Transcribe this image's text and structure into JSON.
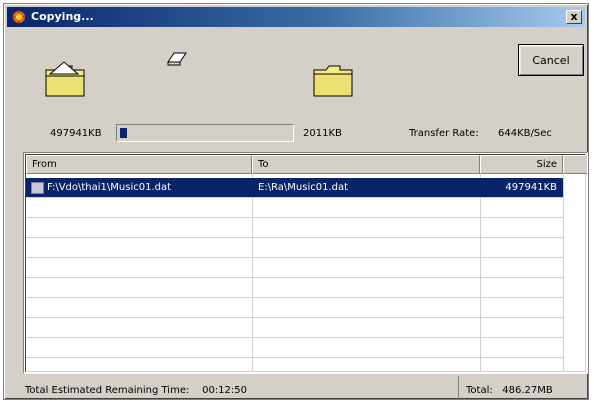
{
  "window": {
    "title": "Copying...",
    "close_label": "x",
    "icons": {
      "app": "app-icon",
      "source_folder": "source-folder-icon",
      "flying_document": "flying-document-icon",
      "destination_folder": "destination-folder-icon",
      "file": "file-icon"
    }
  },
  "buttons": {
    "cancel_label": "Cancel"
  },
  "progress": {
    "source_size": "497941KB",
    "destination_size": "2011KB",
    "transfer_rate_label": "Transfer Rate:",
    "transfer_rate_value": "644KB/Sec",
    "fraction": 0.04
  },
  "table": {
    "headers": {
      "from": "From",
      "to": "To",
      "size": "Size"
    },
    "rows": [
      {
        "from": "F:\\Vdo\\thai1\\Music01.dat",
        "to": "E:\\Ra\\Music01.dat",
        "size": "497941KB",
        "selected": true
      }
    ],
    "empty_rows": 9
  },
  "status": {
    "remaining_label": "Total Estimated Remaining Time:",
    "remaining_value": "00:12:50",
    "total_label": "Total:",
    "total_value": "486.27MB"
  },
  "colors": {
    "title_bar": "#0a246a",
    "selection": "#0a246a",
    "progress_fill": "#0a246a",
    "folder": "#f4ec84",
    "dialog_face": "#d4d0c8"
  }
}
